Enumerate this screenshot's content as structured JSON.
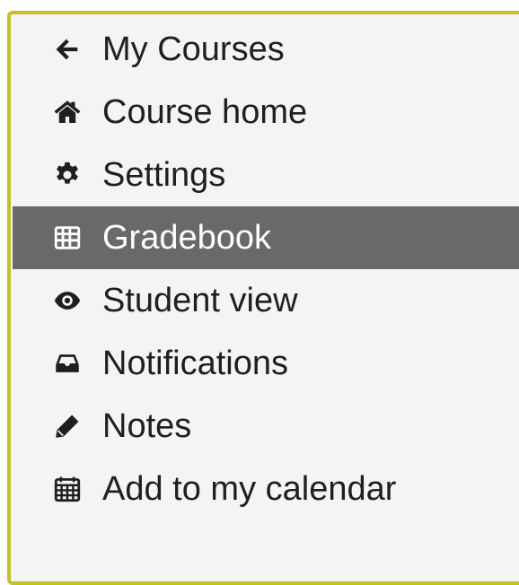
{
  "theme": {
    "border_color": "#c3c12a",
    "panel_background": "#f4f4f4",
    "active_background": "#696969",
    "text_color": "#1f1f1f",
    "active_text_color": "#ffffff"
  },
  "menu": {
    "active_index": 3,
    "items": [
      {
        "label": "My Courses",
        "icon": "arrow-left-icon"
      },
      {
        "label": "Course home",
        "icon": "home-icon"
      },
      {
        "label": "Settings",
        "icon": "gear-icon"
      },
      {
        "label": "Gradebook",
        "icon": "table-icon"
      },
      {
        "label": "Student view",
        "icon": "eye-icon"
      },
      {
        "label": "Notifications",
        "icon": "inbox-icon"
      },
      {
        "label": "Notes",
        "icon": "pencil-icon"
      },
      {
        "label": "Add to my calendar",
        "icon": "calendar-icon"
      }
    ]
  }
}
